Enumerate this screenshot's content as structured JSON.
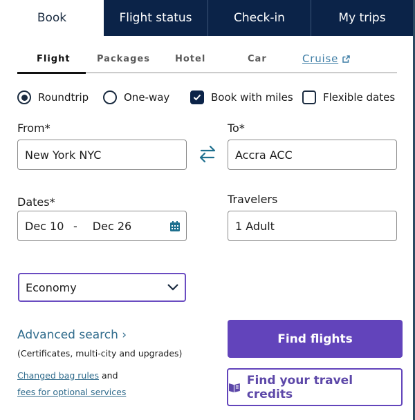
{
  "top_tabs": [
    {
      "label": "Book",
      "active": true
    },
    {
      "label": "Flight status",
      "active": false
    },
    {
      "label": "Check-in",
      "active": false
    },
    {
      "label": "My trips",
      "active": false
    }
  ],
  "sub_tabs": [
    {
      "label": "Flight",
      "active": true
    },
    {
      "label": "Packages",
      "active": false
    },
    {
      "label": "Hotel",
      "active": false
    },
    {
      "label": "Car",
      "active": false
    },
    {
      "label": "Cruise",
      "active": false,
      "external": true
    }
  ],
  "trip_options": {
    "roundtrip": {
      "label": "Roundtrip",
      "selected": true
    },
    "oneway": {
      "label": "One-way",
      "selected": false
    },
    "book_with_miles": {
      "label": "Book with miles",
      "checked": true
    },
    "flexible_dates": {
      "label": "Flexible dates",
      "checked": false
    }
  },
  "from": {
    "label": "From*",
    "value": "New York NYC"
  },
  "to": {
    "label": "To*",
    "value": "Accra ACC"
  },
  "dates": {
    "label": "Dates*",
    "depart": "Dec 10",
    "separator": "-",
    "return": "Dec 26"
  },
  "travelers": {
    "label": "Travelers",
    "value": "1 Adult"
  },
  "cabin": {
    "selected": "Economy"
  },
  "advanced_search": {
    "label": "Advanced search",
    "chevron": "›",
    "subtitle": "(Certificates, multi-city and upgrades)"
  },
  "bag_rules": {
    "link1": "Changed bag rules",
    "connector": " and",
    "link2": "fees for optional services"
  },
  "buttons": {
    "find_flights": "Find flights",
    "travel_credits": "Find your travel credits"
  },
  "colors": {
    "navy": "#0b2348",
    "purple": "#6244bb",
    "link": "#2f6b8c",
    "swap": "#1e6f8e"
  }
}
